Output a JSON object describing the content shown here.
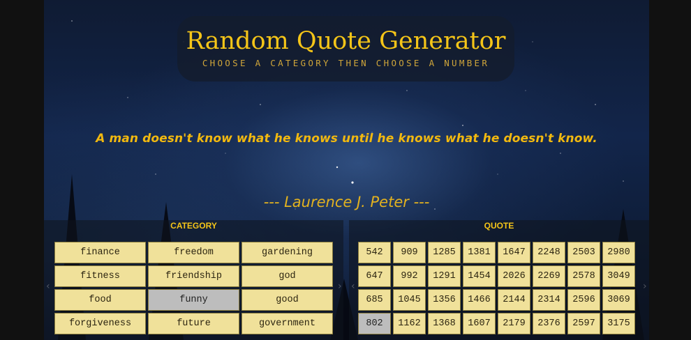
{
  "header": {
    "title": "Random Quote Generator",
    "subtitle": "CHOOSE A CATEGORY THEN CHOOSE A NUMBER"
  },
  "quote": {
    "text": "A man doesn't know what he knows until he knows what he doesn't know.",
    "author": "--- Laurence J. Peter ---"
  },
  "category_panel": {
    "heading": "CATEGORY",
    "items": [
      "finance",
      "freedom",
      "gardening",
      "fitness",
      "friendship",
      "god",
      "food",
      "funny",
      "good",
      "forgiveness",
      "future",
      "government"
    ],
    "selected": "funny"
  },
  "quote_panel": {
    "heading": "QUOTE",
    "numbers": [
      "542",
      "909",
      "1285",
      "1381",
      "1647",
      "2248",
      "2503",
      "2980",
      "647",
      "992",
      "1291",
      "1454",
      "2026",
      "2269",
      "2578",
      "3049",
      "685",
      "1045",
      "1356",
      "1466",
      "2144",
      "2314",
      "2596",
      "3069",
      "802",
      "1162",
      "1368",
      "1607",
      "2179",
      "2376",
      "2597",
      "3175"
    ],
    "selected": "802"
  },
  "colors": {
    "accent": "#f5c518",
    "cell": "#f0e19a",
    "cell_selected": "#bdbdbd"
  }
}
